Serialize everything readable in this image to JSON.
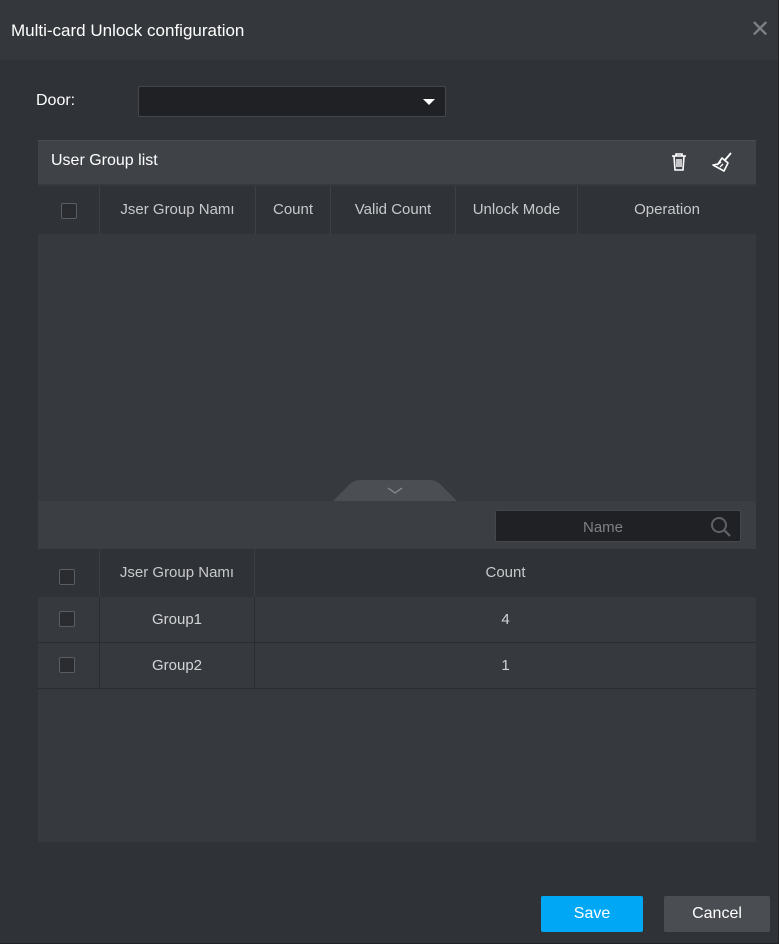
{
  "dialog": {
    "title": "Multi-card Unlock configuration",
    "close_icon": "close-icon"
  },
  "door": {
    "label": "Door:",
    "selected_value": ""
  },
  "upper": {
    "title": "User Group list",
    "delete_icon": "trash-icon",
    "clear_icon": "broom-icon",
    "columns": [
      "Jser Group Namı",
      "Count",
      "Valid Count",
      "Unlock Mode",
      "Operation"
    ],
    "rows": []
  },
  "lower": {
    "search_placeholder": "Name",
    "search_value": "",
    "columns": [
      "Jser Group Namı",
      "Count"
    ],
    "rows": [
      {
        "name": "Group1",
        "count": "4"
      },
      {
        "name": "Group2",
        "count": "1"
      }
    ]
  },
  "footer": {
    "save_label": "Save",
    "cancel_label": "Cancel"
  },
  "colors": {
    "background": "#2f3237",
    "accent": "#00a7f5",
    "text": "#ffffff"
  }
}
